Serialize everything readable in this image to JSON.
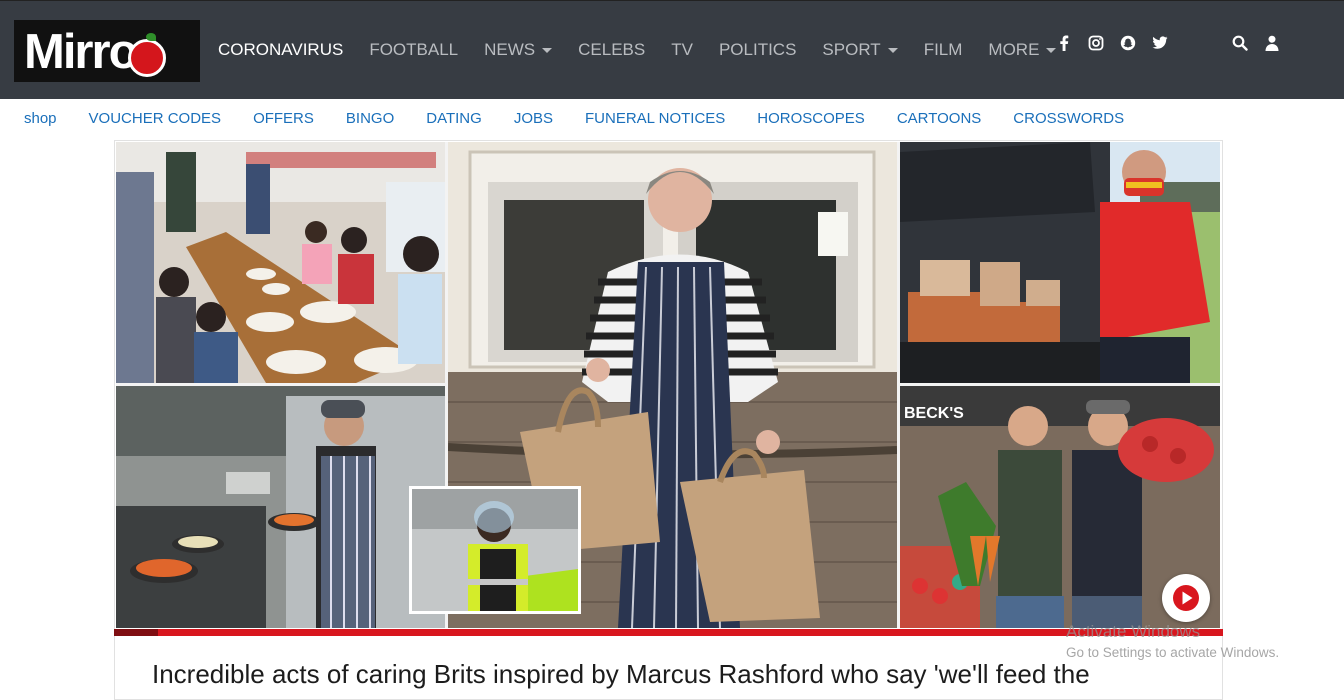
{
  "logo": {
    "text": "Mirror"
  },
  "main_nav": [
    {
      "label": "CORONAVIRUS",
      "active": true,
      "dropdown": false
    },
    {
      "label": "FOOTBALL",
      "active": false,
      "dropdown": false
    },
    {
      "label": "NEWS",
      "active": false,
      "dropdown": true
    },
    {
      "label": "CELEBS",
      "active": false,
      "dropdown": false
    },
    {
      "label": "TV",
      "active": false,
      "dropdown": false
    },
    {
      "label": "POLITICS",
      "active": false,
      "dropdown": false
    },
    {
      "label": "SPORT",
      "active": false,
      "dropdown": true
    },
    {
      "label": "FILM",
      "active": false,
      "dropdown": false
    },
    {
      "label": "MORE",
      "active": false,
      "dropdown": true
    }
  ],
  "social_icons": [
    "facebook-icon",
    "instagram-icon",
    "snapchat-icon",
    "twitter-icon"
  ],
  "tool_icons": [
    "search-icon",
    "user-icon"
  ],
  "sub_nav": [
    "shop",
    "VOUCHER CODES",
    "OFFERS",
    "BINGO",
    "DATING",
    "JOBS",
    "FUNERAL NOTICES",
    "HOROSCOPES",
    "CARTOONS",
    "CROSSWORDS"
  ],
  "hero": {
    "video_progress": 0.04,
    "shop_sign_text": "BECK'S"
  },
  "headline": "Incredible acts of caring Brits inspired by Marcus Rashford who say 'we'll feed the",
  "os_watermark": {
    "line1": "Activate Windows",
    "line2": "Go to Settings to activate Windows."
  },
  "colors": {
    "topbar": "#373c43",
    "link": "#1a6fba",
    "brand_red": "#d8161e"
  }
}
